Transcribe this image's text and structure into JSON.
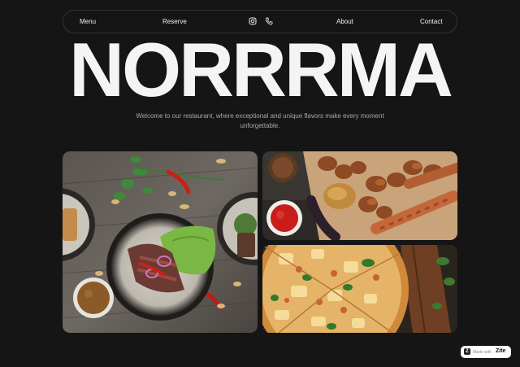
{
  "nav": {
    "menu": "Menu",
    "reserve": "Reserve",
    "instagram_icon": "instagram-icon",
    "phone_icon": "phone-icon",
    "about": "About",
    "contact": "Contact"
  },
  "hero": {
    "title": "NORRRMA"
  },
  "tagline": "Welcome to our restaurant, where exceptional and unique flavors make every moment unforgettable.",
  "badge": {
    "prefix": "Made with",
    "brand": "Zite",
    "logo_letter": "Z"
  },
  "colors": {
    "background": "#151515",
    "text": "#f4f4f4",
    "muted": "#a9a9a9"
  }
}
